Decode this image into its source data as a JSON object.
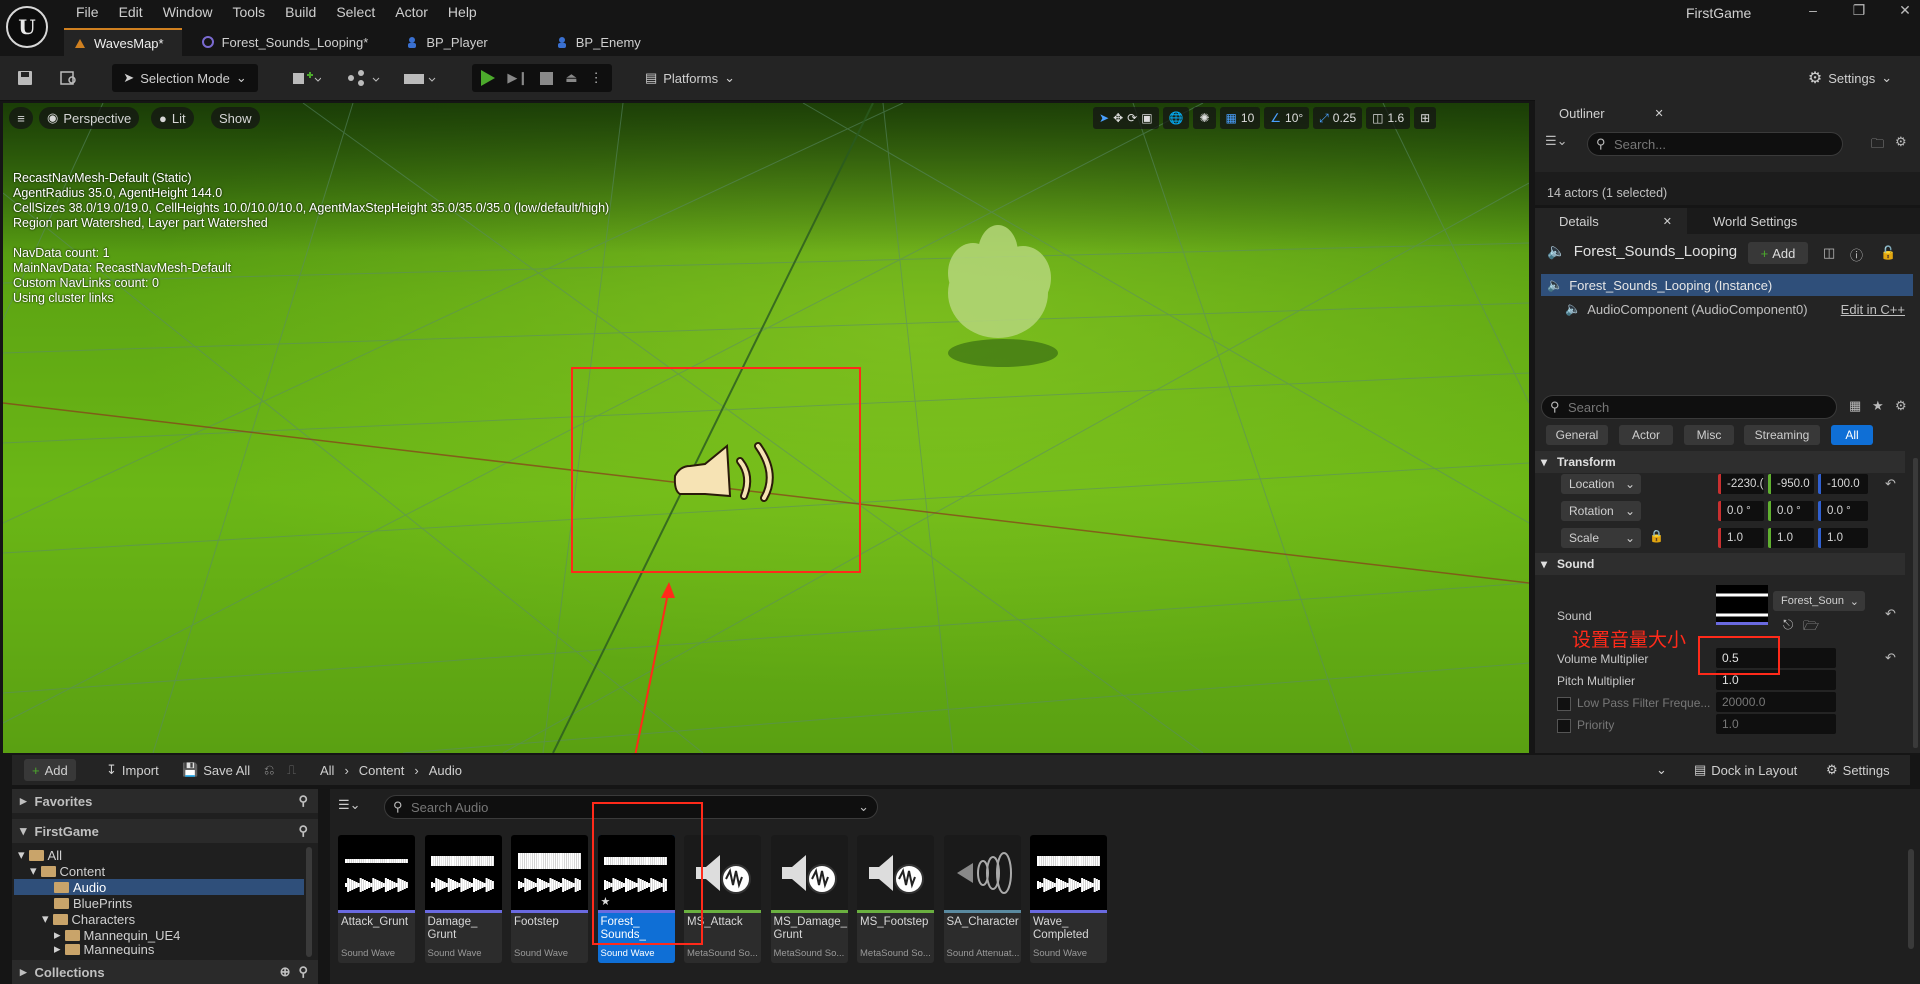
{
  "app": {
    "title": "FirstGame",
    "menu": [
      "File",
      "Edit",
      "Window",
      "Tools",
      "Build",
      "Select",
      "Actor",
      "Help"
    ],
    "tabs": [
      {
        "label": "WavesMap*",
        "active": true
      },
      {
        "label": "Forest_Sounds_Looping*",
        "active": false
      },
      {
        "label": "BP_Player",
        "active": false
      },
      {
        "label": "BP_Enemy",
        "active": false
      }
    ],
    "window_controls": [
      "–",
      "❐",
      "✕"
    ]
  },
  "toolbar": {
    "selection_mode": "Selection Mode",
    "platforms": "Platforms",
    "settings": "Settings"
  },
  "viewport": {
    "menu_icon": "≡",
    "perspective": "Perspective",
    "lit": "Lit",
    "show": "Show",
    "grid_snap": "10",
    "angle_snap": "10°",
    "scale_snap": "0.25",
    "camera_speed": "1.6",
    "navinfo": [
      "RecastNavMesh-Default (Static)",
      "AgentRadius 35.0, AgentHeight 144.0",
      "CellSizes 38.0/19.0/19.0, CellHeights 10.0/10.0/10.0, AgentMaxStepHeight 35.0/35.0/35.0 (low/default/high)",
      "Region part Watershed, Layer part Watershed",
      "",
      "NavData count: 1",
      "MainNavData: RecastNavMesh-Default",
      "Custom NavLinks count: 0",
      "Using cluster links"
    ]
  },
  "outliner": {
    "title": "Outliner",
    "search_placeholder": "Search...",
    "actor_count": "14 actors (1 selected)"
  },
  "details": {
    "tab_details": "Details",
    "tab_world_settings": "World Settings",
    "actor_name": "Forest_Sounds_Looping",
    "add_label": "Add",
    "instance_label": "Forest_Sounds_Looping (Instance)",
    "component_label": "AudioComponent (AudioComponent0)",
    "edit_in_cpp": "Edit in C++",
    "search_placeholder": "Search",
    "filters": [
      "General",
      "Actor",
      "Misc",
      "Streaming",
      "All"
    ],
    "transform": {
      "header": "Transform",
      "location_label": "Location",
      "location": [
        "-2230.(",
        "-950.0",
        "-100.0"
      ],
      "rotation_label": "Rotation",
      "rotation": [
        "0.0 °",
        "0.0 °",
        "0.0 °"
      ],
      "scale_label": "Scale",
      "scale": [
        "1.0",
        "1.0",
        "1.0"
      ]
    },
    "sound": {
      "header": "Sound",
      "sound_label": "Sound",
      "sound_asset": "Forest_Soun",
      "volume_label": "Volume Multiplier",
      "volume_value": "0.5",
      "pitch_label": "Pitch Multiplier",
      "pitch_value": "1.0",
      "lowpass_label": "Low Pass Filter Freque...",
      "lowpass_value": "20000.0",
      "priority_label": "Priority",
      "priority_value": "1.0"
    },
    "annotation": "设置音量大小"
  },
  "content_browser": {
    "add": "Add",
    "import": "Import",
    "save_all": "Save All",
    "breadcrumb": [
      "All",
      "Content",
      "Audio"
    ],
    "dock_in_layout": "Dock in Layout",
    "settings": "Settings",
    "favorites": "Favorites",
    "project": "FirstGame",
    "collections": "Collections",
    "search_placeholder": "Search Audio",
    "tree": [
      {
        "label": "All",
        "level": 0
      },
      {
        "label": "Content",
        "level": 1
      },
      {
        "label": "Audio",
        "level": 2,
        "selected": true
      },
      {
        "label": "BluePrints",
        "level": 2
      },
      {
        "label": "Characters",
        "level": 2
      },
      {
        "label": "Mannequin_UE4",
        "level": 3
      },
      {
        "label": "Mannequins",
        "level": 3
      }
    ],
    "assets": [
      {
        "name": "Attack_Grunt",
        "type": "Sound Wave",
        "kind": "wave"
      },
      {
        "name": "Damage_\nGrunt",
        "type": "Sound Wave",
        "kind": "wave"
      },
      {
        "name": "Footstep",
        "type": "Sound Wave",
        "kind": "wave"
      },
      {
        "name": "Forest_\nSounds_",
        "type": "Sound Wave",
        "kind": "wave",
        "selected": true
      },
      {
        "name": "MS_Attack",
        "type": "MetaSound So...",
        "kind": "meta"
      },
      {
        "name": "MS_Damage_\nGrunt",
        "type": "MetaSound So...",
        "kind": "meta"
      },
      {
        "name": "MS_Footstep",
        "type": "MetaSound So...",
        "kind": "meta"
      },
      {
        "name": "SA_Character",
        "type": "Sound Attenuat...",
        "kind": "atten"
      },
      {
        "name": "Wave_\nCompleted",
        "type": "Sound Wave",
        "kind": "wave"
      }
    ]
  },
  "colors": {
    "accent_orange": "#d08020",
    "highlight_red": "#ff2a1a",
    "selection_blue": "#0f6fd6",
    "play_green": "#4caa2c"
  }
}
